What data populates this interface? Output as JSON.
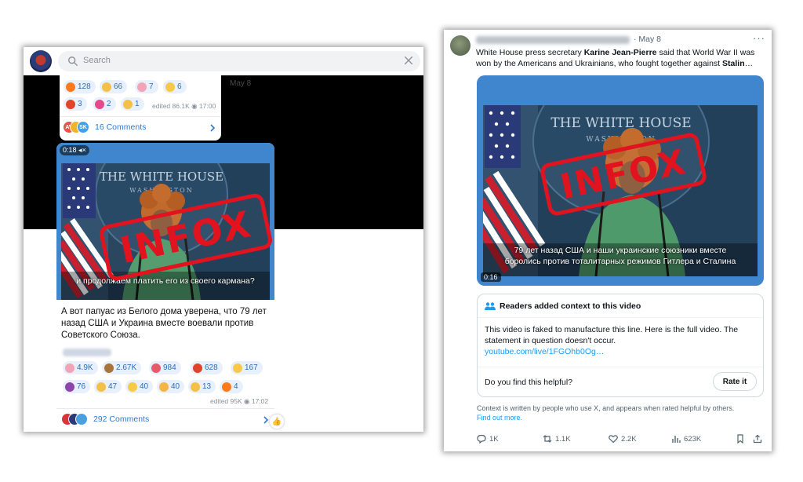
{
  "telegram": {
    "search": {
      "placeholder": "Search"
    },
    "date_chip": "May 8",
    "top_reactions": [
      {
        "emoji": "fire",
        "count": "128"
      },
      {
        "emoji": "clap",
        "count": "66"
      },
      {
        "emoji": "clown",
        "count": "7"
      },
      {
        "emoji": "grin",
        "count": "6"
      },
      {
        "emoji": "angry",
        "count": "3"
      },
      {
        "emoji": "heart-broken",
        "count": "2"
      },
      {
        "emoji": "thumbs-down",
        "count": "1"
      }
    ],
    "top_meta": {
      "edited": "edited",
      "views": "86.1K",
      "time": "17:00"
    },
    "top_comments": {
      "avatars": [
        "AV",
        "",
        "SK"
      ],
      "label": "16 Comments"
    },
    "video": {
      "timer": "0:18",
      "subtitle": "и продолжаем платить его из своего кармана?",
      "stamp": "INFOX"
    },
    "post_text": "А вот папуас из Белого дома уверена, что 79 лет назад США и Украина вместе воевали против Советского Союза.",
    "reactions": [
      {
        "emoji": "clown",
        "count": "4.9K"
      },
      {
        "emoji": "monkey",
        "count": "2.67K"
      },
      {
        "emoji": "pill",
        "count": "984"
      },
      {
        "emoji": "angry",
        "count": "628"
      },
      {
        "emoji": "scream",
        "count": "167"
      },
      {
        "emoji": "devil",
        "count": "76"
      },
      {
        "emoji": "thumbs-up",
        "count": "47"
      },
      {
        "emoji": "grin",
        "count": "40"
      },
      {
        "emoji": "zany",
        "count": "40"
      },
      {
        "emoji": "thumbs-down",
        "count": "13"
      },
      {
        "emoji": "fire",
        "count": "4"
      }
    ],
    "meta": {
      "edited": "edited",
      "views": "95K",
      "time": "17:02"
    },
    "comments": {
      "label": "292 Comments"
    }
  },
  "x_post": {
    "date": "· May 8",
    "text_parts": [
      "White House press secretary ",
      "Karine Jean-Pierre",
      " said that World War II was won by the Americans and Ukrainians, who fought together against ",
      "Stalin",
      "…"
    ],
    "video": {
      "subtitle_line1": "79 лет назад США и наши украинские союзники вместе",
      "subtitle_line2": "боролись против тоталитарных режимов Гитлера и Сталина",
      "time": "0:16",
      "stamp": "INFOX"
    },
    "community_note": {
      "header": "Readers added context to this video",
      "body": "This video is faked to manufacture this line. Here is the full video. The statement in question doesn't occur.",
      "link": "youtube.com/live/1FGOhb0Og…",
      "question": "Do you find this helpful?",
      "rate_button": "Rate it"
    },
    "footer": {
      "text": "Context is written by people who use X, and appears when rated helpful by others.",
      "link": "Find out more."
    },
    "actions": {
      "replies": "1K",
      "reposts": "1.1K",
      "likes": "2.2K",
      "views": "623K"
    },
    "colors": {
      "link": "#1d9bf0",
      "stamp": "#e0131f"
    }
  },
  "frame_text": {
    "seal_top": "THE WHITE HOUSE",
    "seal_bottom": "WASHINGTON"
  }
}
